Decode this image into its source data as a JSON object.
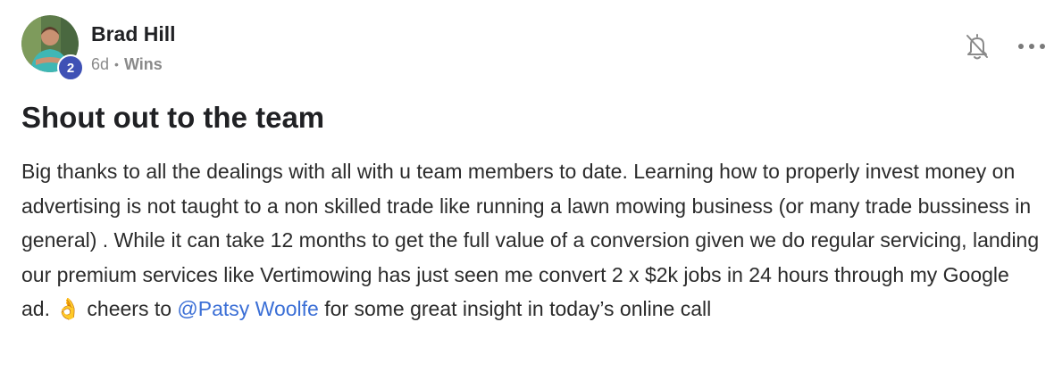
{
  "author": {
    "name": "Brad Hill",
    "level": "2"
  },
  "meta": {
    "time": "6d",
    "separator": "•",
    "category": "Wins"
  },
  "icons": {
    "notification": "bell-off-icon",
    "more": "more-horizontal-icon"
  },
  "post": {
    "title": "Shout out to the team",
    "body_before_mention": "Big thanks to all the dealings with all with u team members to date. Learning how to properly invest money on advertising is not taught to a non skilled trade like running a lawn mowing business (or many trade bussiness in general) . While it can take 12 months to get the full value of a conversion given we do regular servicing, landing our premium services like Vertimowing has just seen me convert 2 x $2k jobs in 24 hours through my Google ad. ",
    "emoji": "👌",
    "body_mid": " cheers to ",
    "mention": "@Patsy Woolfe",
    "body_after_mention": " for some great insight in today’s online call"
  },
  "colors": {
    "badge": "#3f51b5",
    "mention": "#3b6fd6"
  }
}
